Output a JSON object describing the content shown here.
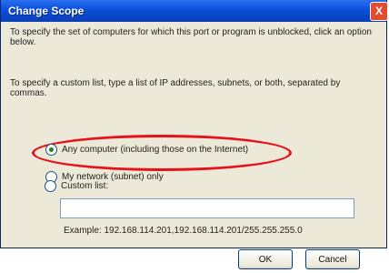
{
  "window": {
    "title": "Change Scope",
    "close_label": "X"
  },
  "text": {
    "intro": "To specify the set of computers for which this port or program is unblocked, click an option below.",
    "custom_hint": "To specify a custom list, type a list of IP addresses, subnets, or both, separated by commas."
  },
  "options": [
    {
      "label": "Any computer (including those on the Internet)",
      "selected": true
    },
    {
      "label": "My network (subnet) only",
      "selected": false
    },
    {
      "label": "Custom list:",
      "selected": false
    }
  ],
  "custom_list": {
    "value": "",
    "example": "Example: 192.168.114.201,192.168.114.201/255.255.255.0"
  },
  "buttons": {
    "ok": "OK",
    "cancel": "Cancel"
  },
  "colors": {
    "title_bar": "#0a4fd8",
    "highlight": "#e8101a"
  }
}
